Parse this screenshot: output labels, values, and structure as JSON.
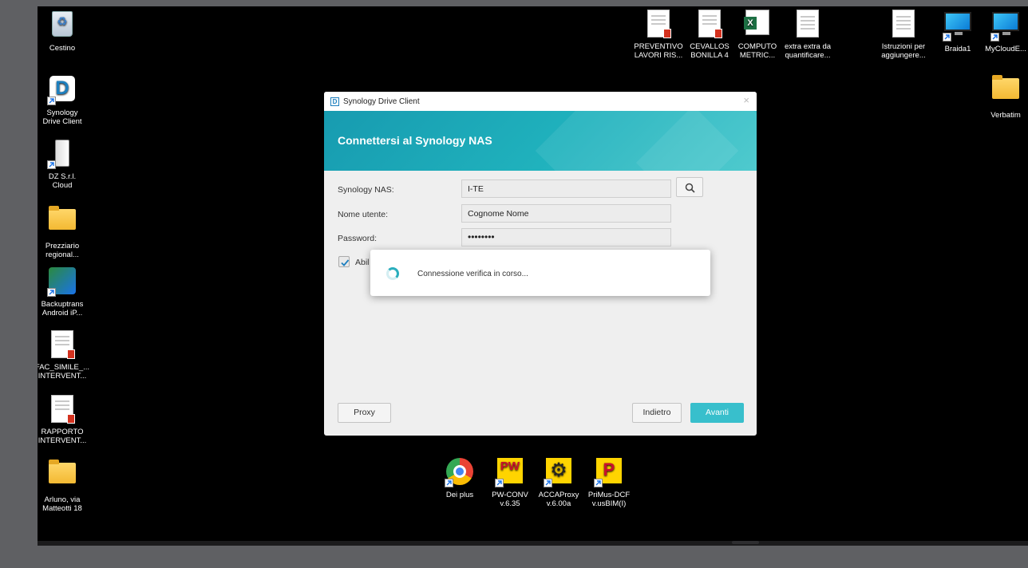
{
  "desktop": {
    "left_icons": [
      {
        "label": "Cestino",
        "icon": "recycle-bin-icon"
      },
      {
        "label": "Synology\nDrive Client",
        "icon": "synology-drive-icon"
      },
      {
        "label": "DZ S.r.l.\nCloud",
        "icon": "external-drive-icon"
      },
      {
        "label": "Prezziario\nregional...",
        "icon": "folder-icon"
      },
      {
        "label": "Backuptrans\nAndroid iP...",
        "icon": "backuptrans-icon"
      },
      {
        "label": "FAC_SIMILE_...\nINTERVENT...",
        "icon": "pdf-document-icon"
      },
      {
        "label": "RAPPORTO\nINTERVENT...",
        "icon": "pdf-document-icon"
      },
      {
        "label": "Arluno, via\nMatteotti 18",
        "icon": "folder-icon"
      }
    ],
    "top_icons": [
      {
        "label": "PREVENTIVO\nLAVORI RIS...",
        "icon": "pdf-document-icon"
      },
      {
        "label": "CEVALLOS\nBONILLA 4",
        "icon": "pdf-document-icon"
      },
      {
        "label": "COMPUTO\nMETRIC...",
        "icon": "excel-icon"
      },
      {
        "label": "extra extra da\nquantificare...",
        "icon": "document-icon"
      },
      {
        "label": "Istruzioni per\naggiungere...",
        "icon": "document-icon"
      },
      {
        "label": "Braida1",
        "icon": "monitor-icon"
      },
      {
        "label": "MyCloudE...",
        "icon": "monitor-icon"
      },
      {
        "label": "Verbatim",
        "icon": "folder-icon"
      }
    ],
    "bottom_icons": [
      {
        "label": "Dei plus",
        "icon": "chrome-icon"
      },
      {
        "label": "PW-CONV\nv.6.35",
        "icon": "pw-conv-icon"
      },
      {
        "label": "ACCAProxy\nv.6.00a",
        "icon": "gear-icon"
      },
      {
        "label": "PriMus-DCF\nv.usBIM(I)",
        "icon": "primus-icon"
      }
    ]
  },
  "dialog": {
    "app_icon_text": "D",
    "window_title": "Synology Drive Client",
    "close_glyph": "×",
    "heading": "Connettersi al Synology NAS",
    "fields": {
      "nas": {
        "label": "Synology NAS:",
        "value": "I-TE"
      },
      "username": {
        "label": "Nome utente:",
        "value": "Cognome Nome"
      },
      "password": {
        "label": "Password:",
        "value": "••••••••"
      }
    },
    "checkbox": {
      "label": "Abil",
      "checked": true
    },
    "buttons": {
      "proxy": "Proxy",
      "back": "Indietro",
      "next": "Avanti"
    },
    "progress_message": "Connessione verifica in corso..."
  },
  "colors": {
    "banner": "#1fa9b8",
    "primary_button": "#38bfcc",
    "desktop_bg": "#000000"
  }
}
